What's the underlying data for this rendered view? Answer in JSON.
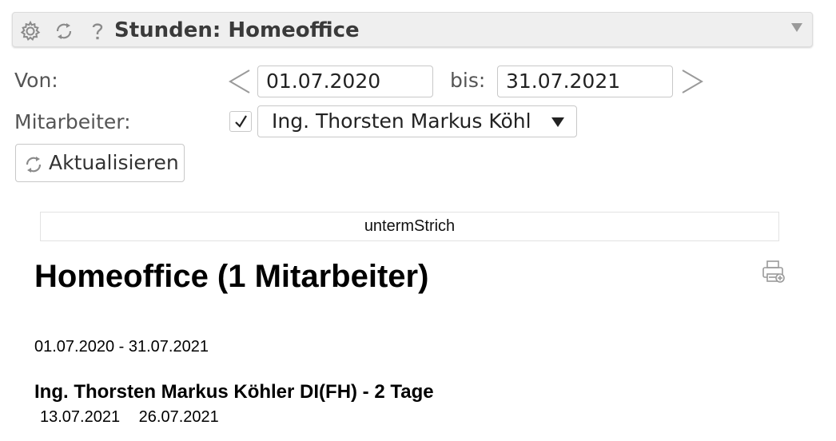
{
  "header": {
    "title": "Stunden: Homeoffice",
    "icons": [
      "settings-gear-icon",
      "refresh-icon",
      "help-question-icon",
      "collapse-triangle-icon"
    ]
  },
  "filters": {
    "from_label": "Von:",
    "from_value": "01.07.2020",
    "to_label": "bis:",
    "to_value": "31.07.2021",
    "employee_label": "Mitarbeiter:",
    "employee_checkbox_checked": true,
    "employee_selected": "Ing. Thorsten Markus Köhl",
    "refresh_label": "Aktualisieren"
  },
  "report": {
    "frame_label": "untermStrich",
    "title": "Homeoffice (1 Mitarbeiter)",
    "date_range": "01.07.2020 - 31.07.2021",
    "employees": [
      {
        "heading": "Ing. Thorsten Markus Köhler DI(FH) - 2 Tage",
        "days": [
          "13.07.2021",
          "26.07.2021"
        ]
      }
    ]
  },
  "colors": {
    "header_bg": "#efefef",
    "border": "#c8c8c8",
    "label_text": "#555555",
    "icon_gray": "#8a8a8a"
  }
}
